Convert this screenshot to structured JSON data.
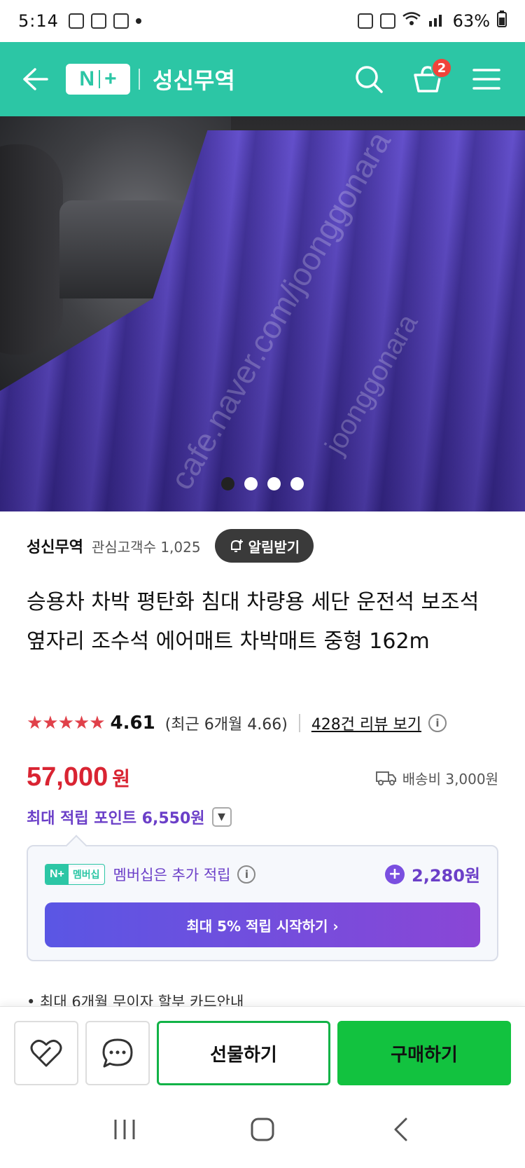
{
  "status_bar": {
    "time": "5:14",
    "battery": "63%"
  },
  "header": {
    "logo": "N+",
    "store_title": "성신무역",
    "cart_count": "2"
  },
  "gallery": {
    "watermark1": "cafe.naver.com/joonggonara",
    "watermark2": "joonggonara",
    "slide_count": 4,
    "active_slide": 1
  },
  "store": {
    "name": "성신무역",
    "followers": "관심고객수 1,025",
    "alarm_label": "알림받기"
  },
  "product": {
    "title": "승용차 차박 평탄화 침대 차량용 세단 운전석 보조석 옆자리 조수석 에어매트 차박매트 중형 162m"
  },
  "rating": {
    "stars": "★★★★★",
    "score": "4.61",
    "recent": "(최근 6개월 4.66)",
    "reviews": "428건 리뷰 보기"
  },
  "price": {
    "amount": "57,000",
    "unit": "원",
    "shipping": "배송비 3,000원"
  },
  "points": {
    "max_points": "최대 적립 포인트 6,550원"
  },
  "membership": {
    "badge_np": "N+",
    "badge_label": "멤버십",
    "text": "멤버십은 추가 적립",
    "extra_points": "2,280원",
    "start_label": "최대 5% 적립 시작하기 ›"
  },
  "card": {
    "text": "• 최대 6개월 무이자 할부 카드안내"
  },
  "actions": {
    "gift_label": "선물하기",
    "buy_label": "구매하기"
  },
  "colors": {
    "brand": "#2cc6a5",
    "price": "#d92432",
    "points": "#6b3fc8",
    "buy": "#12c23f"
  }
}
